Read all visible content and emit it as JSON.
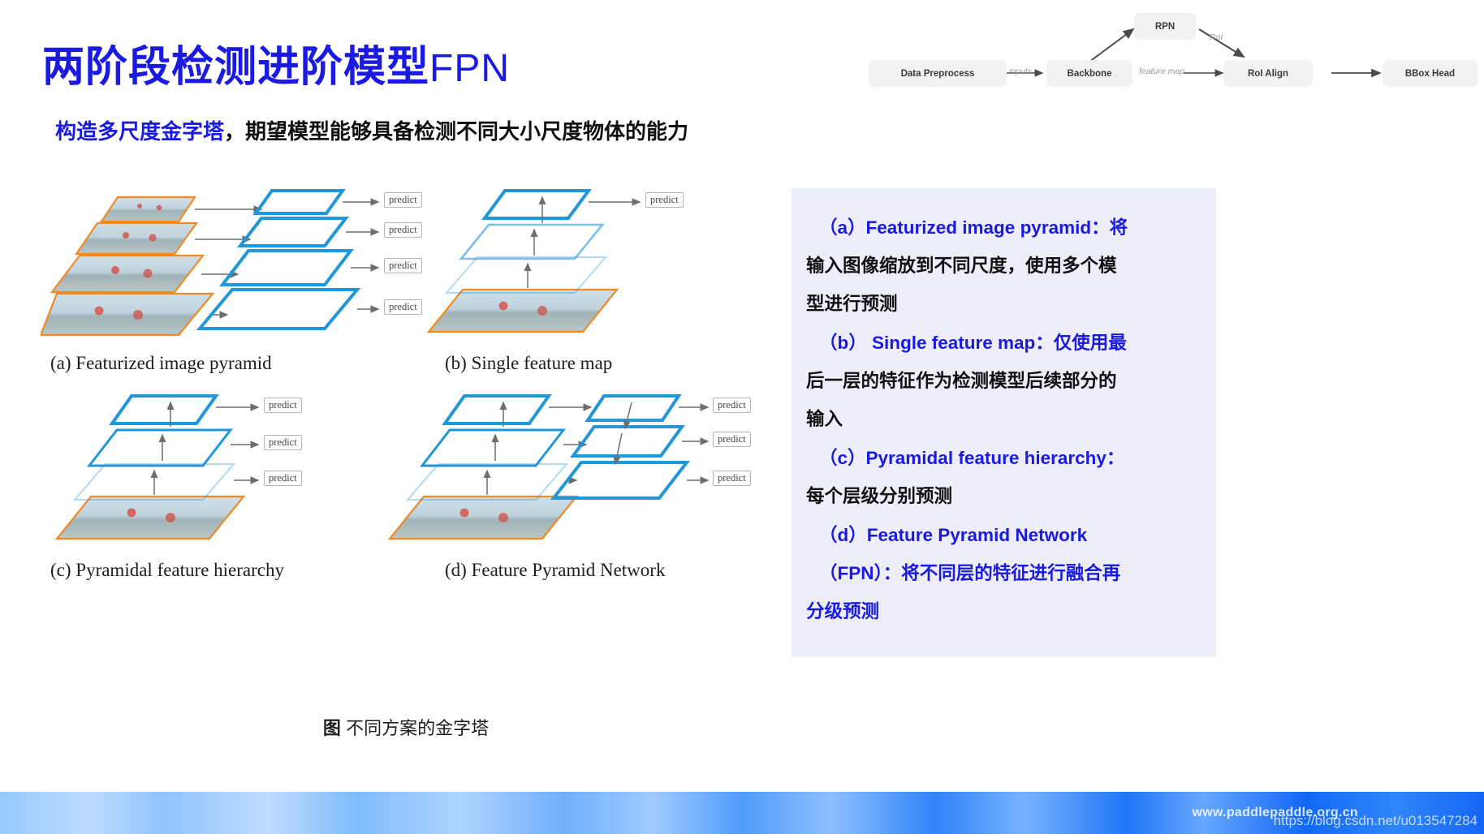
{
  "header": {
    "title_cn": "两阶段检测进阶模型",
    "title_en": "FPN",
    "subtitle_highlight": "构造多尺度金字塔",
    "subtitle_rest": "，期望模型能够具备检测不同大小尺度物体的能力",
    "title_color": "#1A1AE0"
  },
  "pipeline": {
    "nodes": [
      {
        "id": "data-preprocess",
        "label": "Data Preprocess"
      },
      {
        "id": "backbone",
        "label": "Backbone"
      },
      {
        "id": "rpn",
        "label": "RPN"
      },
      {
        "id": "roi-align",
        "label": "RoI Align"
      },
      {
        "id": "bbox-head",
        "label": "BBox Head"
      }
    ],
    "edge_labels": [
      {
        "id": "inputs",
        "label": "inputs"
      },
      {
        "id": "feature-map",
        "label": "feature map"
      },
      {
        "id": "roi",
        "label": "RoI"
      }
    ]
  },
  "figure": {
    "subfigures": [
      {
        "id": "a",
        "caption": "(a) Featurized image pyramid",
        "predicts": [
          "predict",
          "predict",
          "predict",
          "predict"
        ]
      },
      {
        "id": "b",
        "caption": "(b) Single feature map",
        "predicts": [
          "predict"
        ]
      },
      {
        "id": "c",
        "caption": "(c) Pyramidal feature hierarchy",
        "predicts": [
          "predict",
          "predict",
          "predict"
        ]
      },
      {
        "id": "d",
        "caption": "(d) Feature Pyramid Network",
        "predicts": [
          "predict",
          "predict",
          "predict"
        ]
      }
    ],
    "bottom_caption_label": "图",
    "bottom_caption_text": "不同方案的金字塔",
    "colors": {
      "image_border": "#F08A24",
      "feature_map": "#2196D9",
      "arrow": "#6e6e6e"
    }
  },
  "side_panel": {
    "background": "#eeeefb",
    "lines": [
      {
        "id": "a-head",
        "text": "（a）Featurized image pyramid：将",
        "color": "blue",
        "indent": true
      },
      {
        "id": "a-body-1",
        "text": "输入图像缩放到不同尺度，使用多个模",
        "color": "black",
        "indent": false
      },
      {
        "id": "a-body-2",
        "text": "型进行预测",
        "color": "black",
        "indent": false
      },
      {
        "id": "b-head",
        "text": "（b） Single feature map：仅使用最",
        "color": "blue",
        "indent": true
      },
      {
        "id": "b-body-1",
        "text": "后一层的特征作为检测模型后续部分的",
        "color": "black",
        "indent": false
      },
      {
        "id": "b-body-2",
        "text": "输入",
        "color": "black",
        "indent": false
      },
      {
        "id": "c-head",
        "text": "（c）Pyramidal feature hierarchy：",
        "color": "blue",
        "indent": true
      },
      {
        "id": "c-body-1",
        "text": "每个层级分别预测",
        "color": "black",
        "indent": false
      },
      {
        "id": "d-head",
        "text": "（d）Feature Pyramid Network",
        "color": "blue",
        "indent": true
      },
      {
        "id": "d-head-2",
        "text": "（FPN）：将不同层的特征进行融合再",
        "color": "blue",
        "indent": true
      },
      {
        "id": "d-body-1",
        "text": "分级预测",
        "color": "blue",
        "indent": false
      }
    ]
  },
  "footer": {
    "watermark_site": "www.paddlepaddle.org.cn",
    "watermark_blog": "https://blog.csdn.net/u013547284"
  }
}
